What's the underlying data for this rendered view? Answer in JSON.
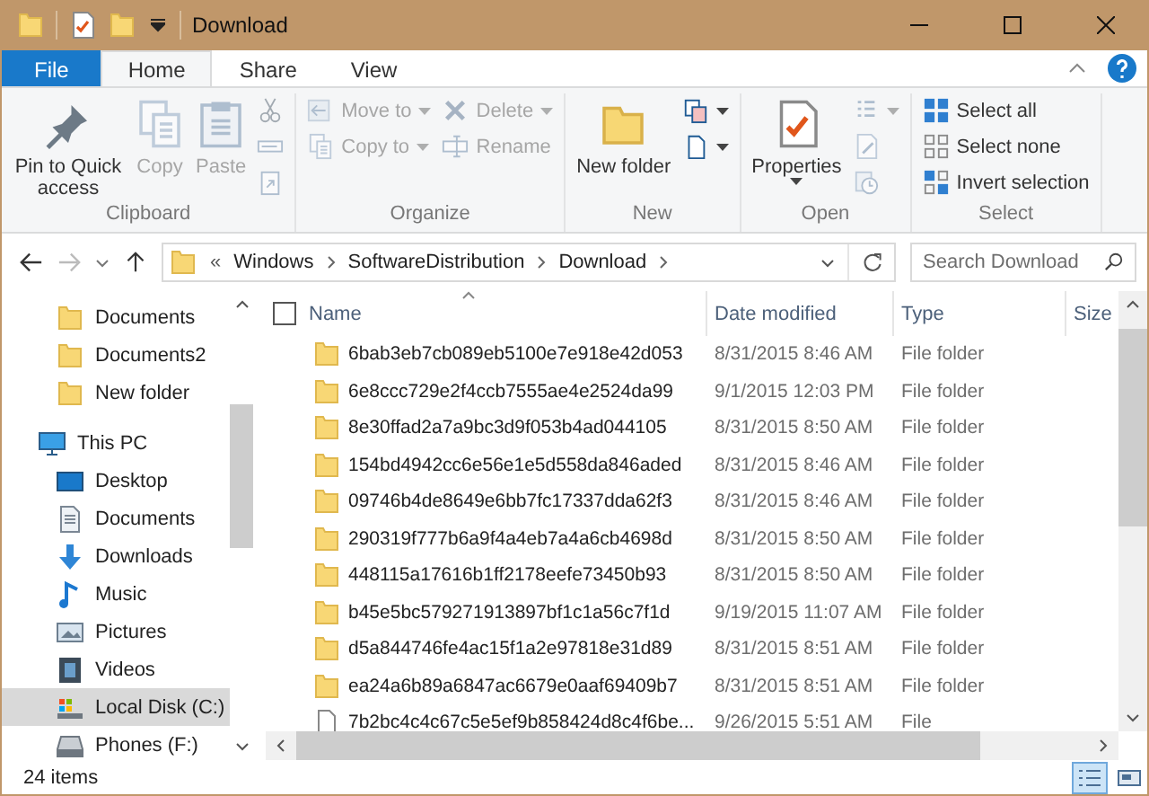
{
  "window": {
    "title": "Download"
  },
  "tabs": [
    {
      "label": "File",
      "kind": "file",
      "selected": false
    },
    {
      "label": "Home",
      "kind": "tab",
      "selected": true
    },
    {
      "label": "Share",
      "kind": "tab",
      "selected": false
    },
    {
      "label": "View",
      "kind": "tab",
      "selected": false
    }
  ],
  "ribbon": [
    {
      "label": "Clipboard",
      "columns": [
        {
          "kind": "large",
          "buttons": [
            {
              "label": "Pin to Quick access",
              "kind": "pin",
              "disabled": false,
              "dropdown": false
            }
          ]
        },
        {
          "kind": "large",
          "buttons": [
            {
              "label": "Copy",
              "kind": "copy",
              "disabled": true,
              "dropdown": false
            }
          ]
        },
        {
          "kind": "large",
          "buttons": [
            {
              "label": "Paste",
              "kind": "paste",
              "disabled": true,
              "dropdown": false
            }
          ]
        },
        {
          "kind": "small",
          "buttons": [
            {
              "kind": "cut",
              "disabled": true,
              "dropdown": false
            },
            {
              "kind": "copy-path",
              "disabled": true,
              "dropdown": false
            },
            {
              "kind": "paste-shortcut",
              "disabled": true,
              "dropdown": false
            }
          ]
        }
      ]
    },
    {
      "label": "Organize",
      "columns": [
        {
          "kind": "small",
          "buttons": [
            {
              "label": "Move to",
              "kind": "move",
              "disabled": true,
              "dropdown": true
            },
            {
              "label": "Copy to",
              "kind": "copy-to",
              "disabled": true,
              "dropdown": true
            }
          ]
        },
        {
          "kind": "small",
          "buttons": [
            {
              "label": "Delete",
              "kind": "delete",
              "disabled": true,
              "dropdown": true
            },
            {
              "label": "Rename",
              "kind": "rename",
              "disabled": true,
              "dropdown": false
            }
          ]
        }
      ]
    },
    {
      "label": "New",
      "columns": [
        {
          "kind": "large",
          "buttons": [
            {
              "label": "New folder",
              "kind": "new-folder",
              "disabled": false,
              "dropdown": false
            }
          ]
        },
        {
          "kind": "small",
          "buttons": [
            {
              "kind": "new-item",
              "disabled": false,
              "dropdown": true
            },
            {
              "kind": "easy-access",
              "disabled": false,
              "dropdown": true
            }
          ]
        }
      ]
    },
    {
      "label": "Open",
      "columns": [
        {
          "kind": "large",
          "buttons": [
            {
              "label": "Properties",
              "kind": "properties",
              "disabled": false,
              "dropdown": true
            }
          ]
        },
        {
          "kind": "small",
          "buttons": [
            {
              "kind": "open",
              "disabled": true,
              "dropdown": true
            },
            {
              "kind": "edit",
              "disabled": true,
              "dropdown": false
            },
            {
              "kind": "history",
              "disabled": true,
              "dropdown": false
            }
          ]
        }
      ]
    },
    {
      "label": "Select",
      "columns": [
        {
          "kind": "small",
          "buttons": [
            {
              "label": "Select all",
              "kind": "select-all",
              "disabled": false,
              "dropdown": false
            },
            {
              "label": "Select none",
              "kind": "select-none",
              "disabled": false,
              "dropdown": false
            },
            {
              "label": "Invert selection",
              "kind": "invert",
              "disabled": false,
              "dropdown": false
            }
          ]
        }
      ]
    }
  ],
  "address": {
    "overflow": "«",
    "crumbs": [
      "Windows",
      "SoftwareDistribution",
      "Download"
    ]
  },
  "search": {
    "placeholder": "Search Download"
  },
  "quick_access_items": [
    {
      "label": "Documents",
      "kind": "folder",
      "selected": false
    },
    {
      "label": "Documents2",
      "kind": "folder",
      "selected": false
    },
    {
      "label": "New folder",
      "kind": "folder",
      "selected": false
    }
  ],
  "this_pc": {
    "label": "This PC",
    "kind": "pc",
    "selected": false,
    "children": [
      {
        "label": "Desktop",
        "kind": "desktop",
        "selected": false
      },
      {
        "label": "Documents",
        "kind": "documents",
        "selected": false
      },
      {
        "label": "Downloads",
        "kind": "downloads",
        "selected": false
      },
      {
        "label": "Music",
        "kind": "music",
        "selected": false
      },
      {
        "label": "Pictures",
        "kind": "pictures",
        "selected": false
      },
      {
        "label": "Videos",
        "kind": "videos",
        "selected": false
      },
      {
        "label": "Local Disk (C:)",
        "kind": "disk",
        "selected": true
      },
      {
        "label": "Phones (F:)",
        "kind": "drive",
        "selected": false
      }
    ]
  },
  "table": {
    "select_all_checked": false,
    "columns": [
      "Name",
      "Date modified",
      "Type",
      "Size"
    ],
    "rows": [
      {
        "name": "6bab3eb7cb089eb5100e7e918e42d053",
        "date": "8/31/2015 8:46 AM",
        "type": "File folder",
        "kind": "folder"
      },
      {
        "name": "6e8ccc729e2f4ccb7555ae4e2524da99",
        "date": "9/1/2015 12:03 PM",
        "type": "File folder",
        "kind": "folder"
      },
      {
        "name": "8e30ffad2a7a9bc3d9f053b4ad044105",
        "date": "8/31/2015 8:50 AM",
        "type": "File folder",
        "kind": "folder"
      },
      {
        "name": "154bd4942cc6e56e1e5d558da846aded",
        "date": "8/31/2015 8:46 AM",
        "type": "File folder",
        "kind": "folder"
      },
      {
        "name": "09746b4de8649e6bb7fc17337dda62f3",
        "date": "8/31/2015 8:46 AM",
        "type": "File folder",
        "kind": "folder"
      },
      {
        "name": "290319f777b6a9f4a4eb7a4a6cb4698d",
        "date": "8/31/2015 8:50 AM",
        "type": "File folder",
        "kind": "folder"
      },
      {
        "name": "448115a17616b1ff2178eefe73450b93",
        "date": "8/31/2015 8:50 AM",
        "type": "File folder",
        "kind": "folder"
      },
      {
        "name": "b45e5bc579271913897bf1c1a56c7f1d",
        "date": "9/19/2015 11:07 AM",
        "type": "File folder",
        "kind": "folder"
      },
      {
        "name": "d5a844746fe4ac15f1a2e97818e31d89",
        "date": "8/31/2015 8:51 AM",
        "type": "File folder",
        "kind": "folder"
      },
      {
        "name": "ea24a6b89a6847ac6679e0aaf69409b7",
        "date": "8/31/2015 8:51 AM",
        "type": "File folder",
        "kind": "folder"
      },
      {
        "name": "7b2bc4c4c67c5e5ef9b858424d8c4f6be...",
        "date": "9/26/2015 5:51 AM",
        "type": "File",
        "kind": "file"
      }
    ]
  },
  "status_bar": {
    "count": "24 items",
    "views": [
      {
        "kind": "details",
        "selected": true
      },
      {
        "kind": "large-icons",
        "selected": false
      }
    ]
  }
}
